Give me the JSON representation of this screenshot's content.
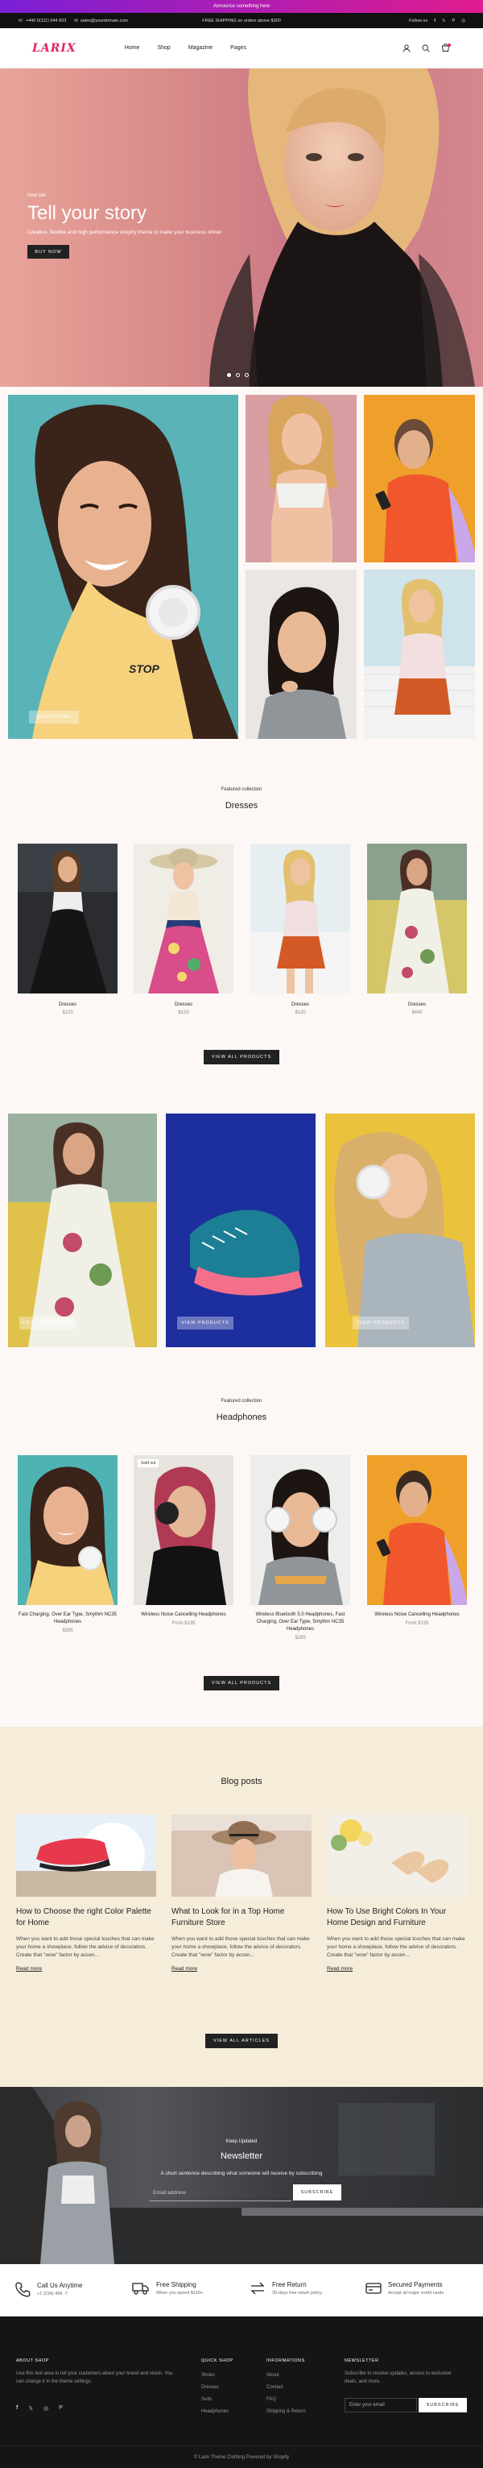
{
  "announcement": "Announce something here",
  "topbar": {
    "phone": "+440 0(111) 044 833",
    "email": "sales@yourdomain.com",
    "shipping": "FREE SHIPPING on orders above $300",
    "follow": "Follow us"
  },
  "header": {
    "logo": "LARIX",
    "nav": [
      "Home",
      "Shop",
      "Magazine",
      "Pages"
    ]
  },
  "hero": {
    "subtitle": "New site",
    "title": "Tell your story",
    "description": "Creative, flexible and high performance shopify theme to make your business shine!",
    "button": "BUY NOW",
    "slide_count": 3,
    "active_slide": 1
  },
  "gallery1": {
    "tag": "HEADPHONE"
  },
  "dresses": {
    "subtitle": "Featured collection",
    "title": "Dresses",
    "products": [
      {
        "name": "Dresses",
        "price": "$120"
      },
      {
        "name": "Dresses",
        "price": "$120"
      },
      {
        "name": "Dresses",
        "price": "$120"
      },
      {
        "name": "Dresses",
        "price": "$440"
      }
    ],
    "button": "VIEW ALL PRODUCTS"
  },
  "gallery2": {
    "tags": [
      "VIEW HEADPHONE",
      "VIEW PRODUCTS",
      "VIEW PRODUCTS"
    ]
  },
  "headphones": {
    "subtitle": "Featured collection",
    "title": "Headphones",
    "badge": "Sold out",
    "products": [
      {
        "name": "Fast Charging, Over Ear Type, Smythm NC35 Headphones",
        "price": "$285"
      },
      {
        "name": "Wireless Noise Cancelling Headphones",
        "price": "From $135"
      },
      {
        "name": "Wireless Bluetooth 5.0 Headphones, Fast Charging, Over Ear Type, Smythm NC35 Headphones",
        "price": "$285"
      },
      {
        "name": "Wireless Noise Cancelling Headphones",
        "price": "From $135"
      }
    ],
    "button": "VIEW ALL PRODUCTS"
  },
  "blog": {
    "title": "Blog posts",
    "posts": [
      {
        "title": "How to Choose the right Color Palette for Home",
        "excerpt": "When you want to add those special touches that can make your home a showplace, follow the advice of decorators. Create that \"wow\" factor by accen...",
        "more": "Read more"
      },
      {
        "title": "What to Look for in a Top Home Furniture Store",
        "excerpt": "When you want to add those special touches that can make your home a showplace, follow the advice of decorators. Create that \"wow\" factor by accen...",
        "more": "Read more"
      },
      {
        "title": "How To Use Bright Colors In Your Home Design and Furniture",
        "excerpt": "When you want to add those special touches that can make your home a showplace, follow the advice of decorators. Create that \"wow\" factor by accen...",
        "more": "Read more"
      }
    ],
    "button": "VIEW ALL ARTICLES"
  },
  "newsletter": {
    "subtitle": "Keep Updated",
    "title": "Newsletter",
    "text": "A short sentence describing what someone will receive by subscribing",
    "placeholder": "Email address",
    "button": "SUBSCRIBE"
  },
  "features": [
    {
      "title": "Call Us Anytime",
      "text": "+1 (234) 456 -7"
    },
    {
      "title": "Free Shipping",
      "text": "When you spend $120+"
    },
    {
      "title": "Free Return",
      "text": "30-days free return policy"
    },
    {
      "title": "Secured Payments",
      "text": "Accept all major credit cards"
    }
  ],
  "footer": {
    "about_title": "ABOUT SHOP",
    "about_text": "Use this text area to tell your customers about your brand and vision. You can change it in the theme settings.",
    "quick_title": "QUICK SHOP",
    "quick_links": [
      "Shoes",
      "Dresses",
      "Suits",
      "Headphones"
    ],
    "info_title": "INFORMATIONS",
    "info_links": [
      "About",
      "Contact",
      "FAQ",
      "Shipping & Return"
    ],
    "news_title": "NEWSLETTER",
    "news_text": "Subscribe to receive updates, access to exclusive deals, and more.",
    "news_placeholder": "Enter your email",
    "news_button": "SUBSCRIBE",
    "copyright": "© Larix Theme Clothing Powered by Shopify"
  },
  "colors": {
    "brand": "#e0245e",
    "dark": "#222222",
    "blog_bg": "#f5ecda",
    "footer_bg": "#151515"
  }
}
